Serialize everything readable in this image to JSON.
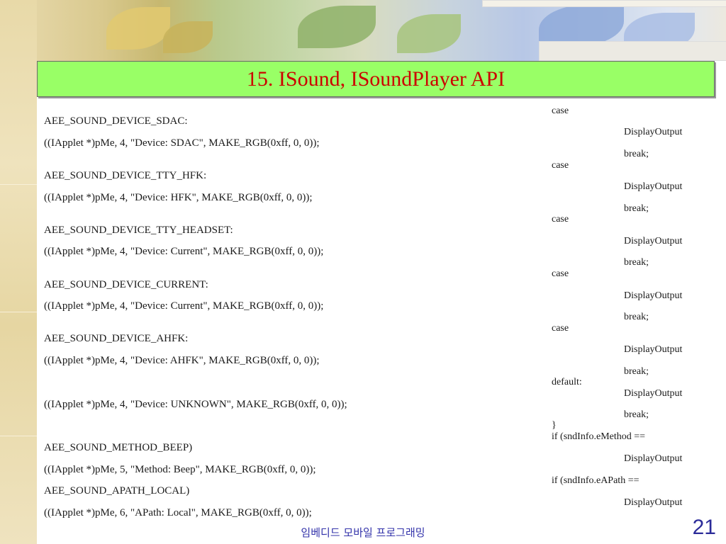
{
  "slide": {
    "title": "15. ISound, ISoundPlayer API",
    "footer": "임베디드 모바일 프로그래밍",
    "page_number": "21"
  },
  "code_left": [
    "AEE_SOUND_DEVICE_SDAC:",
    "((IApplet *)pMe, 4, \"Device: SDAC\", MAKE_RGB(0xff, 0, 0));",
    "AEE_SOUND_DEVICE_TTY_HFK:",
    "((IApplet *)pMe, 4, \"Device: HFK\", MAKE_RGB(0xff, 0, 0));",
    "AEE_SOUND_DEVICE_TTY_HEADSET:",
    "((IApplet *)pMe, 4, \"Device: Current\", MAKE_RGB(0xff, 0, 0));",
    "AEE_SOUND_DEVICE_CURRENT:",
    "((IApplet *)pMe, 4, \"Device: Current\", MAKE_RGB(0xff, 0, 0));",
    "AEE_SOUND_DEVICE_AHFK:",
    "((IApplet *)pMe, 4, \"Device: AHFK\", MAKE_RGB(0xff, 0, 0));",
    "((IApplet *)pMe, 4, \"Device: UNKNOWN\", MAKE_RGB(0xff, 0, 0));",
    "AEE_SOUND_METHOD_BEEP)",
    "((IApplet *)pMe, 5, \"Method: Beep\", MAKE_RGB(0xff, 0, 0));",
    "AEE_SOUND_APATH_LOCAL)",
    "((IApplet *)pMe, 6, \"APath: Local\", MAKE_RGB(0xff, 0, 0));"
  ],
  "code_right": [
    "case",
    "DisplayOutput",
    "break;",
    "case",
    "DisplayOutput",
    "break;",
    "case",
    "DisplayOutput",
    "break;",
    "case",
    "DisplayOutput",
    "break;",
    "case",
    "DisplayOutput",
    "break;",
    "default:",
    "DisplayOutput",
    "break;",
    "}",
    "if (sndInfo.eMethod ==",
    "DisplayOutput",
    "if (sndInfo.eAPath ==",
    "DisplayOutput"
  ]
}
